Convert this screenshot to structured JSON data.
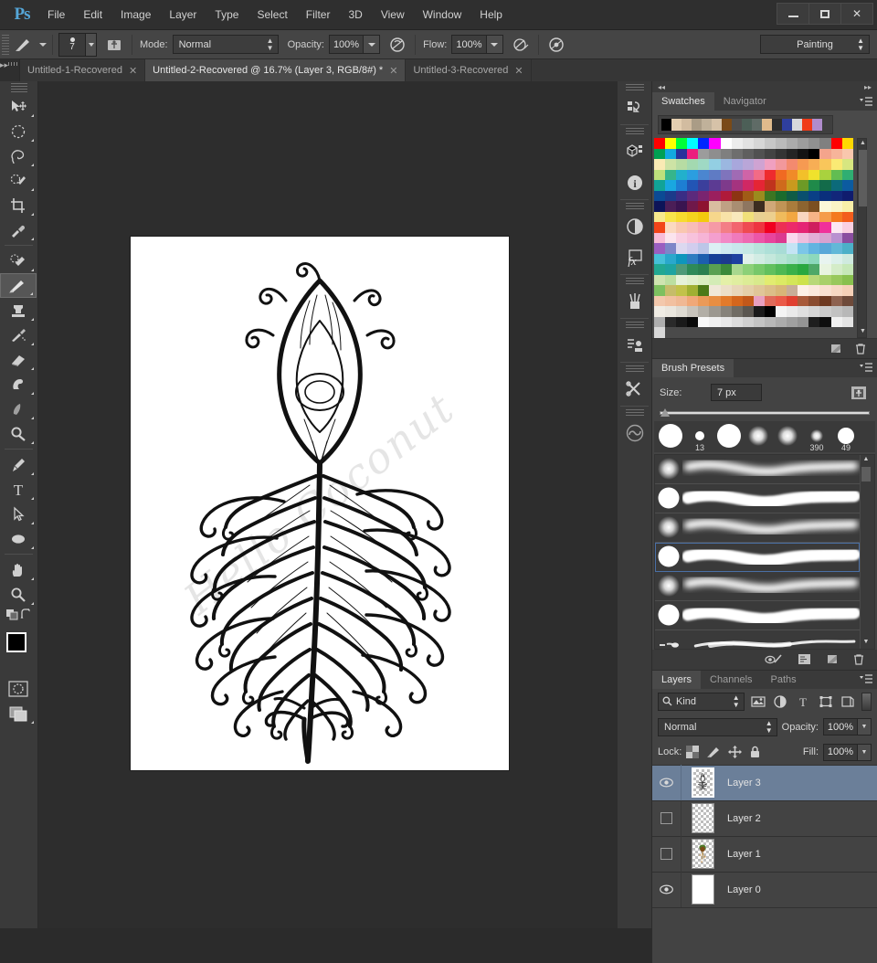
{
  "app": {
    "logo": "Ps",
    "menus": [
      "File",
      "Edit",
      "Image",
      "Layer",
      "Type",
      "Select",
      "Filter",
      "3D",
      "View",
      "Window",
      "Help"
    ],
    "window_controls": {
      "minimize": "minimize-button",
      "maximize": "maximize-button",
      "close": "✕"
    }
  },
  "options_bar": {
    "brush_preview_icon": "brush-icon",
    "brush_size_value": "7",
    "airbrush_toggle_icon": "tablet-pressure-icon",
    "mode_label": "Mode:",
    "mode_value": "Normal",
    "opacity_label": "Opacity:",
    "opacity_value": "100%",
    "opacity_pressure_icon": "pressure-opacity-icon",
    "flow_label": "Flow:",
    "flow_value": "100%",
    "airbrush_icon": "airbrush-icon",
    "pressure_size_icon": "pressure-size-icon",
    "workspace_value": "Painting"
  },
  "tabs": [
    {
      "label": "Untitled-1-Recovered",
      "close": "✕",
      "active": false
    },
    {
      "label": "Untitled-2-Recovered @ 16.7% (Layer 3, RGB/8#) *",
      "close": "✕",
      "active": true
    },
    {
      "label": "Untitled-3-Recovered",
      "close": "✕",
      "active": false
    }
  ],
  "toolbar": {
    "tools": [
      {
        "name": "move-tool",
        "group": 0
      },
      {
        "name": "elliptical-marquee-tool",
        "group": 0
      },
      {
        "name": "lasso-tool",
        "group": 0
      },
      {
        "name": "quick-selection-tool",
        "group": 0
      },
      {
        "name": "crop-tool",
        "group": 0
      },
      {
        "name": "eyedropper-tool",
        "group": 0
      },
      {
        "name": "spot-healing-brush-tool",
        "group": 1
      },
      {
        "name": "brush-tool",
        "group": 1,
        "active": true
      },
      {
        "name": "clone-stamp-tool",
        "group": 1
      },
      {
        "name": "history-brush-tool",
        "group": 1
      },
      {
        "name": "eraser-tool",
        "group": 1
      },
      {
        "name": "gradient-tool",
        "group": 1
      },
      {
        "name": "blur-tool",
        "group": 1
      },
      {
        "name": "dodge-tool",
        "group": 1
      },
      {
        "name": "pen-tool",
        "group": 2
      },
      {
        "name": "type-tool",
        "group": 2
      },
      {
        "name": "path-selection-tool",
        "group": 2
      },
      {
        "name": "ellipse-shape-tool",
        "group": 2
      },
      {
        "name": "hand-tool",
        "group": 3
      },
      {
        "name": "zoom-tool",
        "group": 3
      }
    ],
    "foreground_color": "#000000",
    "background_color": "#173B5E",
    "default-colors-icon": "default-colors-icon",
    "swap-colors-icon": "swap-colors-icon",
    "quick_mask_icon": "quick-mask-icon",
    "screen_mode_icon": "screen-mode-icon"
  },
  "dock_icons": [
    "history-icon",
    "3d-icon",
    "info-icon",
    "adjustments-icon",
    "styles-fx-icon",
    "brush-icon",
    "actions-icon",
    "tools-icon",
    "creative-cloud-icon"
  ],
  "swatches_panel": {
    "tabs": [
      {
        "label": "Swatches",
        "active": true
      },
      {
        "label": "Navigator",
        "active": false
      }
    ],
    "menu_icon": "panel-menu-icon",
    "recent_colors": [
      "#000000",
      "#e4ceb0",
      "#d2bca0",
      "#aa9c86",
      "#c0b19a",
      "#d6c2a8",
      "#7a4a18",
      "#4e4e4e",
      "#4c5f57",
      "#5f6b66",
      "#e0bb8c",
      "#2d2d2d",
      "#2f3f9e",
      "#d8d8dc",
      "#f03a18",
      "#b08ccc"
    ],
    "colors": [
      "#ff0000",
      "#ffff00",
      "#00ff38",
      "#00ffff",
      "#0026ff",
      "#ff00ff",
      "#ffffff",
      "#ededed",
      "#e2e2e2",
      "#d6d6d6",
      "#c7c7c7",
      "#bababa",
      "#ababab",
      "#9d9d9d",
      "#909090",
      "#808080",
      "#ff0000",
      "#ffd800",
      "#00a052",
      "#12a9e0",
      "#27329b",
      "#ec1e7e",
      "#9c9c9c",
      "#8e8e8e",
      "#7f7f7f",
      "#6e6e6e",
      "#5f5f5f",
      "#515151",
      "#434343",
      "#343434",
      "#242424",
      "#131313",
      "#000000",
      "#f4a48c",
      "#f7b49a",
      "#f9c7ad",
      "#faeab4",
      "#cde3a5",
      "#b7dca3",
      "#a3d9b0",
      "#9fd9c4",
      "#93cfe3",
      "#9bb7e0",
      "#a8a7dc",
      "#b9a6d8",
      "#cfa3d2",
      "#f0a0c0",
      "#f2989c",
      "#f38a6f",
      "#f69a52",
      "#f7ae55",
      "#f9c65b",
      "#faea74",
      "#d7e680",
      "#bde07c",
      "#36b58b",
      "#22b0cc",
      "#2b9ee0",
      "#4b86d0",
      "#5f7bc4",
      "#7f74bc",
      "#a06bb4",
      "#cf64a7",
      "#f26b86",
      "#ee2b2e",
      "#f06a22",
      "#f08b28",
      "#f2c02a",
      "#f0e22c",
      "#a9d23e",
      "#62bd52",
      "#2fae72",
      "#11a396",
      "#19a8e0",
      "#1d7fd3",
      "#2255b5",
      "#3b3f9c",
      "#5c3b93",
      "#7e3a8b",
      "#a5337f",
      "#d02864",
      "#e52535",
      "#c0331d",
      "#cf6a1c",
      "#c99a1e",
      "#6d9a26",
      "#1f8a4a",
      "#136b4a",
      "#0c6a7a",
      "#0c5ba0",
      "#0b4a94",
      "#1b3a8a",
      "#3a2d85",
      "#5c2a7c",
      "#7a2470",
      "#9b1f5e",
      "#b01a3a",
      "#8c3412",
      "#a05c16",
      "#9b8b1e",
      "#3c7522",
      "#1a6b2d",
      "#0f5c46",
      "#0a4f6e",
      "#0a3f86",
      "#0a2f7c",
      "#12267a",
      "#101c6e",
      "#0d1458",
      "#4b1e57",
      "#3a1450",
      "#70184a",
      "#8e1230",
      "#d9bda0",
      "#bfa184",
      "#a98e72",
      "#8e7660",
      "#3b2c20",
      "#d0a878",
      "#c09456",
      "#a97c3c",
      "#8c6430",
      "#7b4f22",
      "#fcf8d8",
      "#fbf4c6",
      "#f9efa8",
      "#f7e98e",
      "#f8e44c",
      "#f7db2f",
      "#f5d21e",
      "#f3ca0e",
      "#f6d78c",
      "#f8e2a8",
      "#f9e9bc",
      "#f1e07a",
      "#e8d092",
      "#eccf8e",
      "#f0bb5c",
      "#f2a742",
      "#f9d6c0",
      "#f6b487",
      "#f59c4a",
      "#f4791f",
      "#f35d1c",
      "#f24418",
      "#fbd9c0",
      "#f9c7b0",
      "#f8bcb8",
      "#f7aab4",
      "#f59aa6",
      "#f37e86",
      "#f2646e",
      "#ef4a52",
      "#ee3540",
      "#f00020",
      "#ed2f54",
      "#ec2a6a",
      "#e52474",
      "#cf1f5e",
      "#f0309a",
      "#fce8f2",
      "#fad0e2",
      "#f8bcd8",
      "#fbe4ee",
      "#f9cfe2",
      "#f7c2dc",
      "#f6b4d6",
      "#f49fce",
      "#f28ac6",
      "#f07abc",
      "#ee6ab2",
      "#ec56a8",
      "#e8449c",
      "#dc3990",
      "#fad8ee",
      "#eebedd",
      "#e2aed6",
      "#d8a2d0",
      "#b991d0",
      "#8a4ea0",
      "#9a5ec0",
      "#7d86c8",
      "#dcd8f0",
      "#d2cdee",
      "#bcc6e8",
      "#dcf0f4",
      "#d0eaf0",
      "#c8e8ec",
      "#c4e8e4",
      "#b8e4dc",
      "#aee0d8",
      "#a8dcd6",
      "#c4e4f4",
      "#7cc6e8",
      "#62b4e0",
      "#5aa8d8",
      "#62b8d8",
      "#4cb0c8",
      "#46c0d8",
      "#2aa8cc",
      "#0e96bc",
      "#2e7cc0",
      "#1c5eae",
      "#163f96",
      "#1c3a8e",
      "#1e40a0",
      "#e0f0ea",
      "#d2ece4",
      "#c4e8dc",
      "#b6e4d4",
      "#a8e0cc",
      "#9adcc4",
      "#8cd8bc",
      "#e8f4f0",
      "#dcf0ea",
      "#cfeadf",
      "#22a892",
      "#1ea4a0",
      "#4e9a78",
      "#2e8a58",
      "#2a8050",
      "#5aa052",
      "#3c8a3a",
      "#a8d88e",
      "#8cd078",
      "#76c86a",
      "#62c05e",
      "#4eb854",
      "#3ab04a",
      "#2aa840",
      "#4ea868",
      "#e8f4e0",
      "#d4ecc8",
      "#c6e8b8",
      "#cfe4b0",
      "#bcdfa0",
      "#e6f2d8",
      "#e0f0cc",
      "#daeec0",
      "#d4ecb6",
      "#e4f0a8",
      "#e0eea0",
      "#dcec96",
      "#d8ea8c",
      "#e2ec70",
      "#dcea64",
      "#d4e658",
      "#cee24c",
      "#b8d878",
      "#a8d06a",
      "#98c85c",
      "#88c04e",
      "#7ec060",
      "#c6bc6a",
      "#c2c24a",
      "#a0b032",
      "#4c7a18",
      "#f0e8d8",
      "#ecdfc8",
      "#e8d6b8",
      "#e4cfa8",
      "#e0c698",
      "#dcbe88",
      "#d8b678",
      "#c8ae98",
      "#fdf0e6",
      "#fbe8dc",
      "#f9e0d0",
      "#f7d8c4",
      "#f5d0b8",
      "#f3c8ac",
      "#f2c0a0",
      "#f0b894",
      "#f0a878",
      "#eb9a58",
      "#e88e42",
      "#e27a2a",
      "#d4661c",
      "#c2581a",
      "#e8a0c0",
      "#e06a5a",
      "#ea5a48",
      "#e04030",
      "#a85a3a",
      "#8a4c30",
      "#6e3a22",
      "#8e6250",
      "#6e4a3a",
      "#f0ece4",
      "#eae6de",
      "#dedad2",
      "#c8c4bc",
      "#b2aea6",
      "#9c9890",
      "#86827a",
      "#706c64",
      "#5a5650",
      "#1a1a1a",
      "#000000",
      "#f4f4f4",
      "#eaeaea",
      "#e0e0e0",
      "#d6d6d6",
      "#cccccc",
      "#c2c2c2",
      "#b8b8b8",
      "#aeaeae",
      "#2a2a2a",
      "#1a1a1a",
      "#0a0a0a",
      "#f8f8f8",
      "#f0f0f0",
      "#e8e8e8",
      "#dcdcdc",
      "#d0d0d0",
      "#c4c4c4",
      "#b8b8b8",
      "#acacac",
      "#a0a0a0",
      "#949494",
      "#1e1e1e",
      "#0e0e0e",
      "#f0f0f0",
      "#e4e4e4",
      "#d8d8d8"
    ],
    "footer_icons": [
      "new-swatch-icon",
      "delete-swatch-icon"
    ]
  },
  "brush_presets_panel": {
    "tabs": [
      {
        "label": "Brush Presets",
        "active": true
      }
    ],
    "menu_icon": "panel-menu-icon",
    "size_label": "Size:",
    "size_value": "7 px",
    "folder_icon": "brush-preset-folder-icon",
    "tips": [
      {
        "label": "",
        "kind": "hard-large"
      },
      {
        "label": "13",
        "kind": "hard-small"
      },
      {
        "label": "",
        "kind": "hard-large"
      },
      {
        "label": "",
        "kind": "soft-medium"
      },
      {
        "label": "",
        "kind": "soft-medium"
      },
      {
        "label": "390",
        "kind": "soft-small"
      },
      {
        "label": "49",
        "kind": "hard-medium"
      }
    ],
    "preset_rows": [
      {
        "tip": "soft",
        "selected": false
      },
      {
        "tip": "hard",
        "selected": false
      },
      {
        "tip": "soft",
        "selected": false
      },
      {
        "tip": "hard",
        "selected": true
      },
      {
        "tip": "soft",
        "selected": false
      },
      {
        "tip": "hard",
        "selected": false
      },
      {
        "tip": "tapered",
        "selected": false
      }
    ],
    "footer_icons": [
      "toggle-brush-preview-icon",
      "open-brush-panel-icon",
      "new-brush-icon",
      "delete-brush-icon"
    ]
  },
  "layers_panel": {
    "tabs": [
      {
        "label": "Layers",
        "active": true
      },
      {
        "label": "Channels",
        "active": false
      },
      {
        "label": "Paths",
        "active": false
      }
    ],
    "menu_icon": "panel-menu-icon",
    "filter_label": "Kind",
    "filter_search_icon": "search-icon",
    "filter_icons": [
      "pixel-filter-icon",
      "adjustment-filter-icon",
      "type-filter-icon",
      "shape-filter-icon",
      "smartobject-filter-icon"
    ],
    "blend_mode": "Normal",
    "opacity_label": "Opacity:",
    "opacity_value": "100%",
    "lock_label": "Lock:",
    "lock_icons": [
      "lock-transparent-pixels-icon",
      "lock-image-pixels-icon",
      "lock-position-icon",
      "lock-all-icon"
    ],
    "fill_label": "Fill:",
    "fill_value": "100%",
    "layers": [
      {
        "name": "Layer 3",
        "visible": true,
        "selected": true,
        "thumb": "sketch"
      },
      {
        "name": "Layer 2",
        "visible": false,
        "selected": false,
        "thumb": "empty"
      },
      {
        "name": "Layer 1",
        "visible": false,
        "selected": false,
        "thumb": "color"
      },
      {
        "name": "Layer 0",
        "visible": true,
        "selected": false,
        "thumb": "white"
      }
    ]
  },
  "canvas": {
    "document_title": "Untitled-2-Recovered",
    "zoom": "16.7%",
    "watermark_text": "Hello Coconut",
    "artwork": "peacock-feather-line-drawing"
  }
}
